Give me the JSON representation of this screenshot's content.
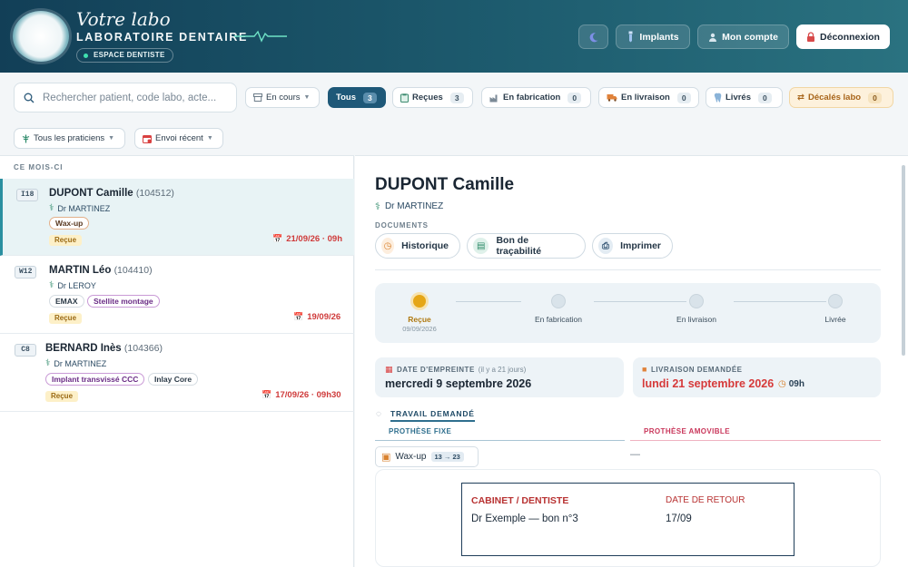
{
  "header": {
    "brand_script": "Votre labo",
    "brand_name": "LABORATOIRE DENTAIRE",
    "space_label": "ESPACE DENTISTE",
    "buttons": {
      "implants": "Implants",
      "account": "Mon compte",
      "logout": "Déconnexion"
    }
  },
  "search": {
    "placeholder": "Rechercher patient, code labo, acte..."
  },
  "filters": {
    "status_select": "En cours",
    "tabs": [
      {
        "label": "Tous",
        "count": "3"
      },
      {
        "label": "Reçues",
        "count": "3"
      },
      {
        "label": "En fabrication",
        "count": "0"
      },
      {
        "label": "En livraison",
        "count": "0"
      },
      {
        "label": "Livrés",
        "count": "0"
      },
      {
        "label": "Décalés labo",
        "count": "0"
      }
    ],
    "practitioner_select": "Tous les praticiens",
    "sort_select": "Envoi récent"
  },
  "list": {
    "section": "CE MOIS-CI",
    "items": [
      {
        "tooth": "I18",
        "name": "DUPONT Camille",
        "code": "(104512)",
        "doctor": "Dr MARTINEZ",
        "tags": [
          "Wax-up"
        ],
        "status": "Reçue",
        "due": "21/09/26 · 09h"
      },
      {
        "tooth": "W12",
        "name": "MARTIN Léo",
        "code": "(104410)",
        "doctor": "Dr LEROY",
        "tags": [
          "EMAX",
          "Stellite montage"
        ],
        "status": "Reçue",
        "due": "19/09/26"
      },
      {
        "tooth": "C8",
        "name": "BERNARD Inès",
        "code": "(104366)",
        "doctor": "Dr MARTINEZ",
        "tags": [
          "Implant transvissé CCC",
          "Inlay Core"
        ],
        "status": "Reçue",
        "due": "17/09/26 · 09h30"
      }
    ]
  },
  "detail": {
    "patient": "DUPONT Camille",
    "doctor": "Dr MARTINEZ",
    "documents_label": "DOCUMENTS",
    "doc_buttons": {
      "history": "Historique",
      "traceability": "Bon de traçabilité",
      "print": "Imprimer"
    },
    "steps": [
      {
        "label": "Reçue",
        "date": "09/09/2026",
        "active": true
      },
      {
        "label": "En fabrication",
        "date": "",
        "active": false
      },
      {
        "label": "En livraison",
        "date": "",
        "active": false
      },
      {
        "label": "Livrée",
        "date": "",
        "active": false
      }
    ],
    "impression": {
      "label": "DATE D'EMPREINTE",
      "sub": "(il y a 21 jours)",
      "value": "mercredi 9 septembre 2026"
    },
    "delivery": {
      "label": "LIVRAISON DEMANDÉE",
      "value": "lundi 21 septembre 2026",
      "time": "09h"
    },
    "work_label": "TRAVAIL DEMANDÉ",
    "fixed_label": "PROTHÈSE FIXE",
    "removable_label": "PROTHÈSE AMOVIBLE",
    "fixed_item": {
      "name": "Wax-up",
      "range": "13 → 23"
    },
    "removable_empty": "—",
    "preview": {
      "cabinet_label": "CABINET / DENTISTE",
      "cabinet_value": "Dr Exemple — bon n°3",
      "return_label": "DATE DE RETOUR",
      "return_value": "17/09"
    }
  },
  "colors": {
    "header_start": "#123f57",
    "header_end": "#2a7280",
    "accent": "#1e5878",
    "overdue_red": "#d63a3a",
    "status_received": "#e5a616"
  }
}
